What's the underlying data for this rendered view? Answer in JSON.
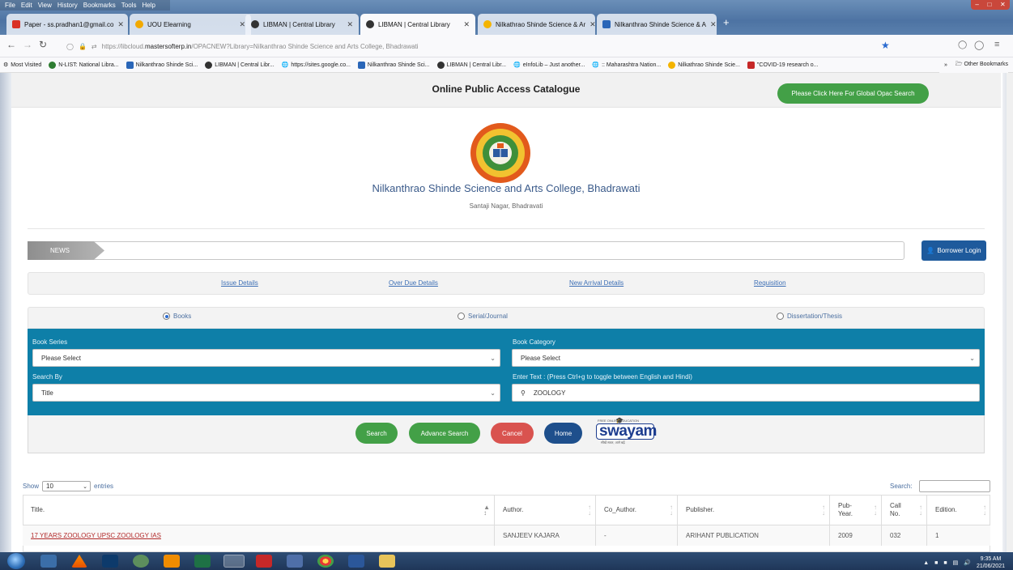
{
  "browser": {
    "menu": [
      "File",
      "Edit",
      "View",
      "History",
      "Bookmarks",
      "Tools",
      "Help"
    ],
    "tabs": [
      {
        "label": "Paper - ss.pradhan1@gmail.co",
        "color": "#d93025"
      },
      {
        "label": "UOU Elearning",
        "color": "#f2a900"
      },
      {
        "label": "LIBMAN | Central Library",
        "color": "#333333"
      },
      {
        "label": "LIBMAN | Central Library",
        "color": "#333333"
      },
      {
        "label": "Nilkathrao Shinde Science & Ar",
        "color": "#f4b400"
      },
      {
        "label": "Nilkanthrao Shinde Science & A",
        "color": "#2a66b8"
      }
    ],
    "url_prefix": "https://libcloud.",
    "url_domain": "mastersofterp.in",
    "url_rest": "/OPACNEW?Library=Nilkanthrao Shinde Science and Arts College, Bhadrawati",
    "bookmarks": [
      "Most Visited",
      "N-LIST: National Libra...",
      "Nilkanthrao Shinde Sci...",
      "LIBMAN | Central Libr...",
      "https://sites.google.co...",
      "Nilkanthrao Shinde Sci...",
      "LIBMAN | Central Libr...",
      "eInfoLib – Just another...",
      ":: Maharashtra Nation...",
      "Nilkathrao Shinde Scie...",
      "\"COVID-19 research o..."
    ],
    "other_bookmarks": "Other Bookmarks"
  },
  "page": {
    "header_title": "Online Public Access Catalogue",
    "global_search_label": "Please Click Here For Global Opac Search",
    "college_name": "Nilkanthrao Shinde Science and Arts College, Bhadrawati",
    "college_address": "Santaji Nagar, Bhadravati",
    "news_label": "NEWS",
    "borrower_login": "Borrower Login",
    "links": [
      "Issue Details",
      "Over Due Details",
      "New Arrival Details",
      "Requisition"
    ],
    "radios": [
      {
        "label": "Books",
        "checked": true
      },
      {
        "label": "Serial/Journal",
        "checked": false
      },
      {
        "label": "Dissertation/Thesis",
        "checked": false
      }
    ],
    "form": {
      "book_series_label": "Book Series",
      "book_series_value": "Please Select",
      "book_category_label": "Book Category",
      "book_category_value": "Please Select",
      "search_by_label": "Search By",
      "search_by_value": "Title",
      "enter_text_label": "Enter Text : (Press Ctrl+g to toggle between English and Hindi)",
      "enter_text_value": "ZOOLOGY"
    },
    "buttons": {
      "search": "Search",
      "advance_search": "Advance Search",
      "cancel": "Cancel",
      "home": "Home"
    },
    "swayam_text": "swayam",
    "swayam_top": "FREE ONLINE EDUCATION",
    "swayam_tagline": "सीखें सतत, आगे बढ़ें",
    "table": {
      "show_label": "Show",
      "entries_value": "10",
      "entries_label": "entries",
      "search_label": "Search:",
      "columns": [
        "Title.",
        "Author.",
        "Co_Author.",
        "Publisher.",
        "Pub-Year.",
        "Call No.",
        "Edition."
      ],
      "rows": [
        {
          "title": "17 YEARS ZOOLOGY UPSC ZOOLOGY IAS",
          "author": "SANJEEV KAJARA",
          "co_author": "-",
          "publisher": "ARIHANT PUBLICATION",
          "pub_year": "2009",
          "call_no": "032",
          "edition": "1"
        }
      ]
    }
  },
  "taskbar": {
    "time": "9:35 AM",
    "date": "21/06/2021"
  },
  "colors": {
    "form_blue": "#0e7fa8",
    "green": "#43a047",
    "red": "#d9534f",
    "navy": "#1e4f8c"
  }
}
